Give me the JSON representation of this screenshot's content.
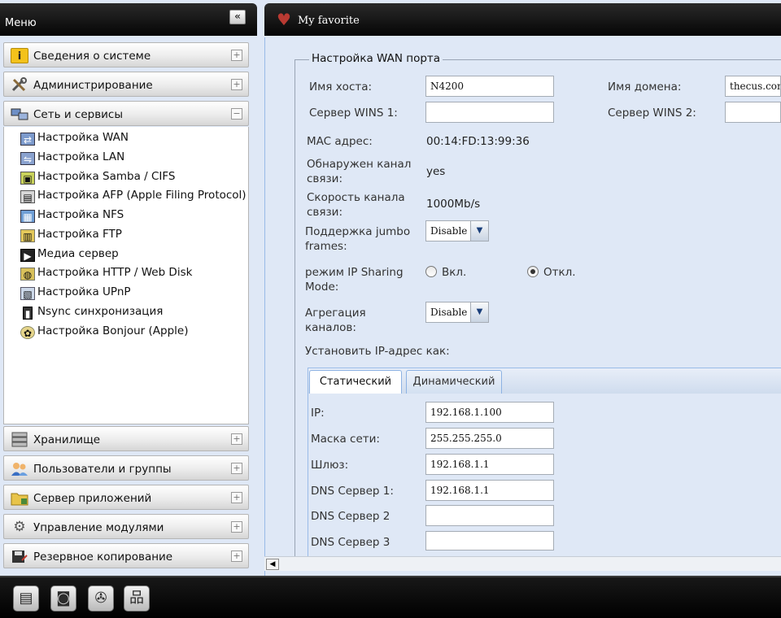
{
  "menu": {
    "title": "Меню",
    "collapse_glyph": "«",
    "sections": [
      {
        "label": "Сведения о системе",
        "icon": "info-icon",
        "toggle": "+"
      },
      {
        "label": "Администрирование",
        "icon": "tools-icon",
        "toggle": "+"
      },
      {
        "label": "Сеть и сервисы",
        "icon": "network-icon",
        "toggle": "−"
      },
      {
        "label": "Хранилище",
        "icon": "storage-icon",
        "toggle": "+"
      },
      {
        "label": "Пользователи и группы",
        "icon": "users-icon",
        "toggle": "+"
      },
      {
        "label": "Сервер приложений",
        "icon": "folder-app-icon",
        "toggle": "+"
      },
      {
        "label": "Управление модулями",
        "icon": "gears-icon",
        "toggle": "+"
      },
      {
        "label": "Резервное копирование",
        "icon": "backup-icon",
        "toggle": "+"
      }
    ],
    "network_items": [
      {
        "label": "Настройка WAN",
        "icon": "wan-icon"
      },
      {
        "label": "Настройка LAN",
        "icon": "lan-icon"
      },
      {
        "label": "Настройка Samba / CIFS",
        "icon": "samba-icon"
      },
      {
        "label": "Настройка AFP (Apple Filing Protocol)",
        "icon": "afp-icon"
      },
      {
        "label": "Настройка NFS",
        "icon": "nfs-icon"
      },
      {
        "label": "Настройка FTP",
        "icon": "ftp-icon"
      },
      {
        "label": "Медиа сервер",
        "icon": "media-server-icon"
      },
      {
        "label": "Настройка HTTP / Web Disk",
        "icon": "http-icon"
      },
      {
        "label": "Настройка UPnP",
        "icon": "upnp-icon"
      },
      {
        "label": "Nsync синхронизация",
        "icon": "nsync-icon"
      },
      {
        "label": "Настройка Bonjour (Apple)",
        "icon": "bonjour-icon"
      }
    ]
  },
  "favorite": {
    "label": "My favorite",
    "icon": "heart-icon"
  },
  "wan": {
    "legend": "Настройка WAN порта",
    "hostname_label": "Имя хоста:",
    "hostname_value": "N4200",
    "domain_label": "Имя домена:",
    "domain_value": "thecus.com",
    "wins1_label": "Сервер WINS 1:",
    "wins1_value": "",
    "wins2_label": "Сервер WINS 2:",
    "wins2_value": "",
    "mac_label": "MAC адрес:",
    "mac_value": "00:14:FD:13:99:36",
    "link_label_1": "Обнаружен канал",
    "link_label_2": "связи:",
    "link_value": "yes",
    "speed_label_1": "Скорость канала",
    "speed_label_2": "связи:",
    "speed_value": "1000Mb/s",
    "jumbo_label_1": "Поддержка jumbo",
    "jumbo_label_2": "frames:",
    "jumbo_value": "Disable",
    "ipsharing_label_1": "режим IP Sharing",
    "ipsharing_label_2": "Mode:",
    "ipsharing_on": "Вкл.",
    "ipsharing_off": "Откл.",
    "ipsharing_selected": "off",
    "aggregation_label_1": "Агрегация",
    "aggregation_label_2": "каналов:",
    "aggregation_value": "Disable",
    "set_ip_label": "Установить IP-адрес как:",
    "tabs": [
      {
        "label": "Статический",
        "active": true
      },
      {
        "label": "Динамический",
        "active": false
      }
    ],
    "ip_label": "IP:",
    "ip_value": "192.168.1.100",
    "mask_label": "Маска сети:",
    "mask_value": "255.255.255.0",
    "gateway_label": "Шлюз:",
    "gateway_value": "192.168.1.1",
    "dns1_label": "DNS Сервер 1:",
    "dns1_value": "192.168.1.1",
    "dns2_label": "DNS Сервер 2",
    "dns2_value": "",
    "dns3_label": "DNS Сервер 3",
    "dns3_value": ""
  },
  "taskbar": {
    "buttons": [
      {
        "icon": "server-rack-icon",
        "glyph": "▤"
      },
      {
        "icon": "disk-icon",
        "glyph": "◙"
      },
      {
        "icon": "fan-icon",
        "glyph": "✇"
      },
      {
        "icon": "network-map-icon",
        "glyph": "品"
      }
    ]
  },
  "colors": {
    "header_black": "#0a0a0a",
    "panel_bg": "#dfe8f6",
    "heart": "#b93a32",
    "tab_border": "#99bbe8"
  }
}
